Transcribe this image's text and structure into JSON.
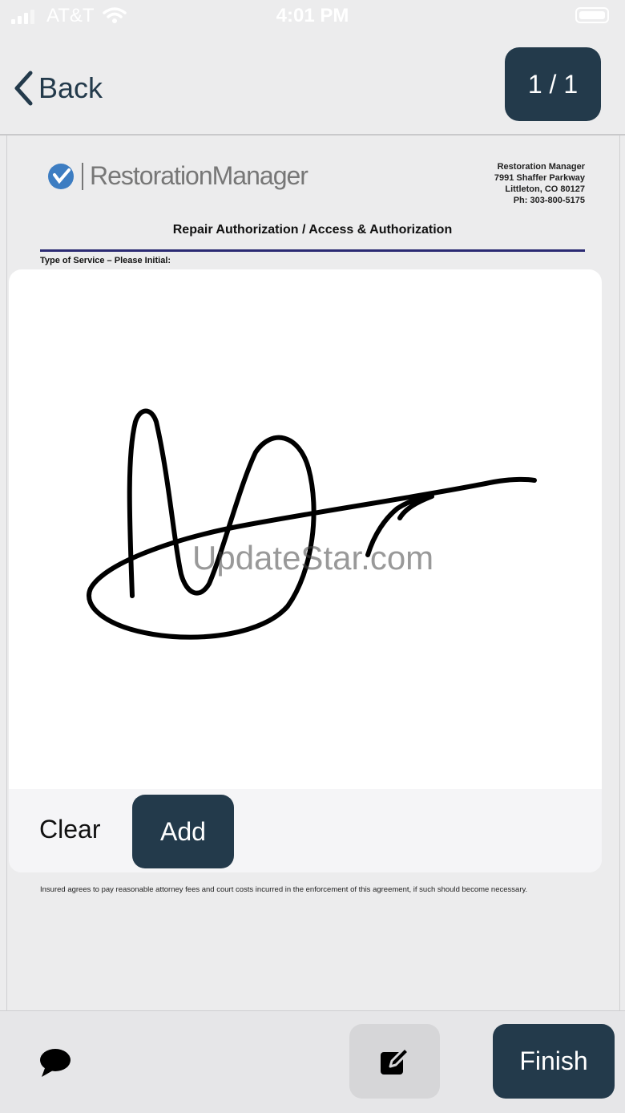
{
  "status_bar": {
    "carrier": "AT&T",
    "time": "4:01 PM"
  },
  "nav": {
    "back_label": "Back",
    "page_indicator": "1 / 1"
  },
  "document": {
    "logo_text": "RestorationManager",
    "address_lines": [
      "Restoration Manager",
      "7991 Shaffer Parkway",
      "Littleton, CO 80127",
      "Ph: 303-800-5175"
    ],
    "title": "Repair Authorization / Access & Authorization",
    "section_label": "Type of Service – Please Initial:",
    "clause": "Insured agrees to pay reasonable attorney fees and court costs incurred in the enforcement of this agreement, if such should become necessary."
  },
  "signature_modal": {
    "watermark": "UpdateStar.com",
    "clear_label": "Clear",
    "add_label": "Add"
  },
  "toolbar": {
    "finish_label": "Finish"
  },
  "colors": {
    "primary": "#233a4b",
    "background": "#ececed",
    "rule": "#2b2a73"
  },
  "icons": [
    "back-chevron-icon",
    "cellular-signal-icon",
    "wifi-icon",
    "battery-icon",
    "comment-icon",
    "edit-icon"
  ]
}
